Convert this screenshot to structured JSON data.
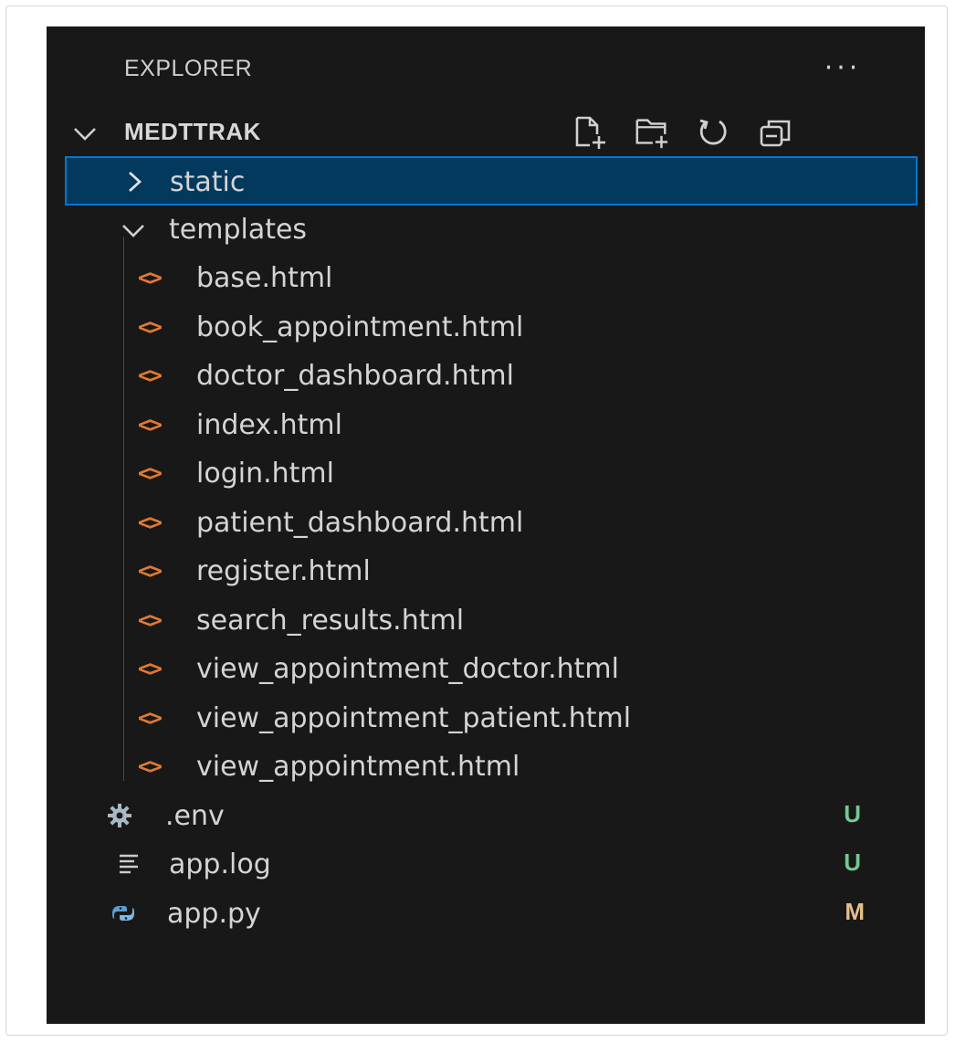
{
  "explorer": {
    "title": "EXPLORER",
    "more_label": "···"
  },
  "root": {
    "label": "MEDTTRAK",
    "expanded": true,
    "actions": [
      {
        "icon": "new-file-icon"
      },
      {
        "icon": "new-folder-icon"
      },
      {
        "icon": "refresh-icon"
      },
      {
        "icon": "collapse-all-icon"
      }
    ]
  },
  "tree": {
    "folders": {
      "static": {
        "label": "static",
        "expanded": false,
        "selected": true
      },
      "templates": {
        "label": "templates",
        "expanded": true
      }
    },
    "template_files": [
      {
        "label": "base.html",
        "icon": "html-file-icon"
      },
      {
        "label": "book_appointment.html",
        "icon": "html-file-icon"
      },
      {
        "label": "doctor_dashboard.html",
        "icon": "html-file-icon"
      },
      {
        "label": "index.html",
        "icon": "html-file-icon"
      },
      {
        "label": "login.html",
        "icon": "html-file-icon"
      },
      {
        "label": "patient_dashboard.html",
        "icon": "html-file-icon"
      },
      {
        "label": "register.html",
        "icon": "html-file-icon"
      },
      {
        "label": "search_results.html",
        "icon": "html-file-icon"
      },
      {
        "label": "view_appointment_doctor.html",
        "icon": "html-file-icon"
      },
      {
        "label": "view_appointment_patient.html",
        "icon": "html-file-icon"
      },
      {
        "label": "view_appointment.html",
        "icon": "html-file-icon"
      }
    ],
    "root_files": [
      {
        "label": ".env",
        "icon": "gear-icon",
        "badge": "U",
        "status": "untracked"
      },
      {
        "label": "app.log",
        "icon": "lines-icon",
        "badge": "U",
        "status": "untracked"
      },
      {
        "label": "app.py",
        "icon": "python-icon",
        "badge": "M",
        "status": "modified"
      }
    ]
  },
  "colors": {
    "panel_bg": "#181818",
    "selection_bg": "#04395e",
    "selection_border": "#0078d4",
    "html_icon": "#e37933",
    "untracked": "#73c991",
    "modified": "#e2c08d"
  }
}
